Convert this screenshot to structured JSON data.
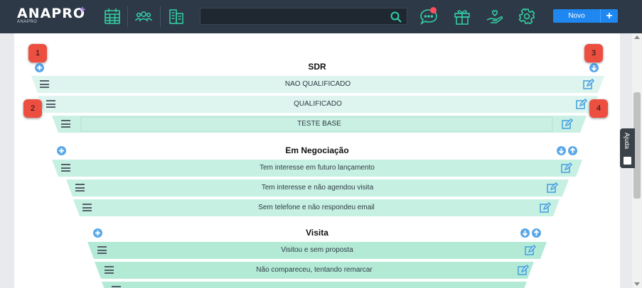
{
  "header": {
    "logo": "ANAPRO",
    "logo_sub": "ANAPRO",
    "search": {
      "value": "",
      "placeholder": ""
    },
    "new_button": "Novo",
    "add_button": "+"
  },
  "help_tab": {
    "label": "Ajuda"
  },
  "badges": [
    "1",
    "2",
    "3",
    "4"
  ],
  "groups": [
    {
      "title": "SDR",
      "rows": [
        "NAO QUALIFICADO",
        "QUALIFICADO",
        "TESTE BASE"
      ]
    },
    {
      "title": "Em Negociação",
      "rows": [
        "Tem interesse em futuro lançamento",
        "Tem interesse e não agendou visita",
        "Sem telefone e não respondeu email"
      ]
    },
    {
      "title": "Visita",
      "rows": [
        "Visitou e sem proposta",
        "Não compareceu, tentando remarcar",
        ""
      ]
    }
  ],
  "colors": {
    "topbar": "#2d3946",
    "accent_icons": "#34d1a8",
    "new_button": "#1f87f0",
    "row_sdr": "#ddf5ee",
    "row_negociacao": "#c6f0e1",
    "row_visita": "#b3ead6",
    "badge": "#ec4e40",
    "circle_button": "#5aa7e8"
  }
}
